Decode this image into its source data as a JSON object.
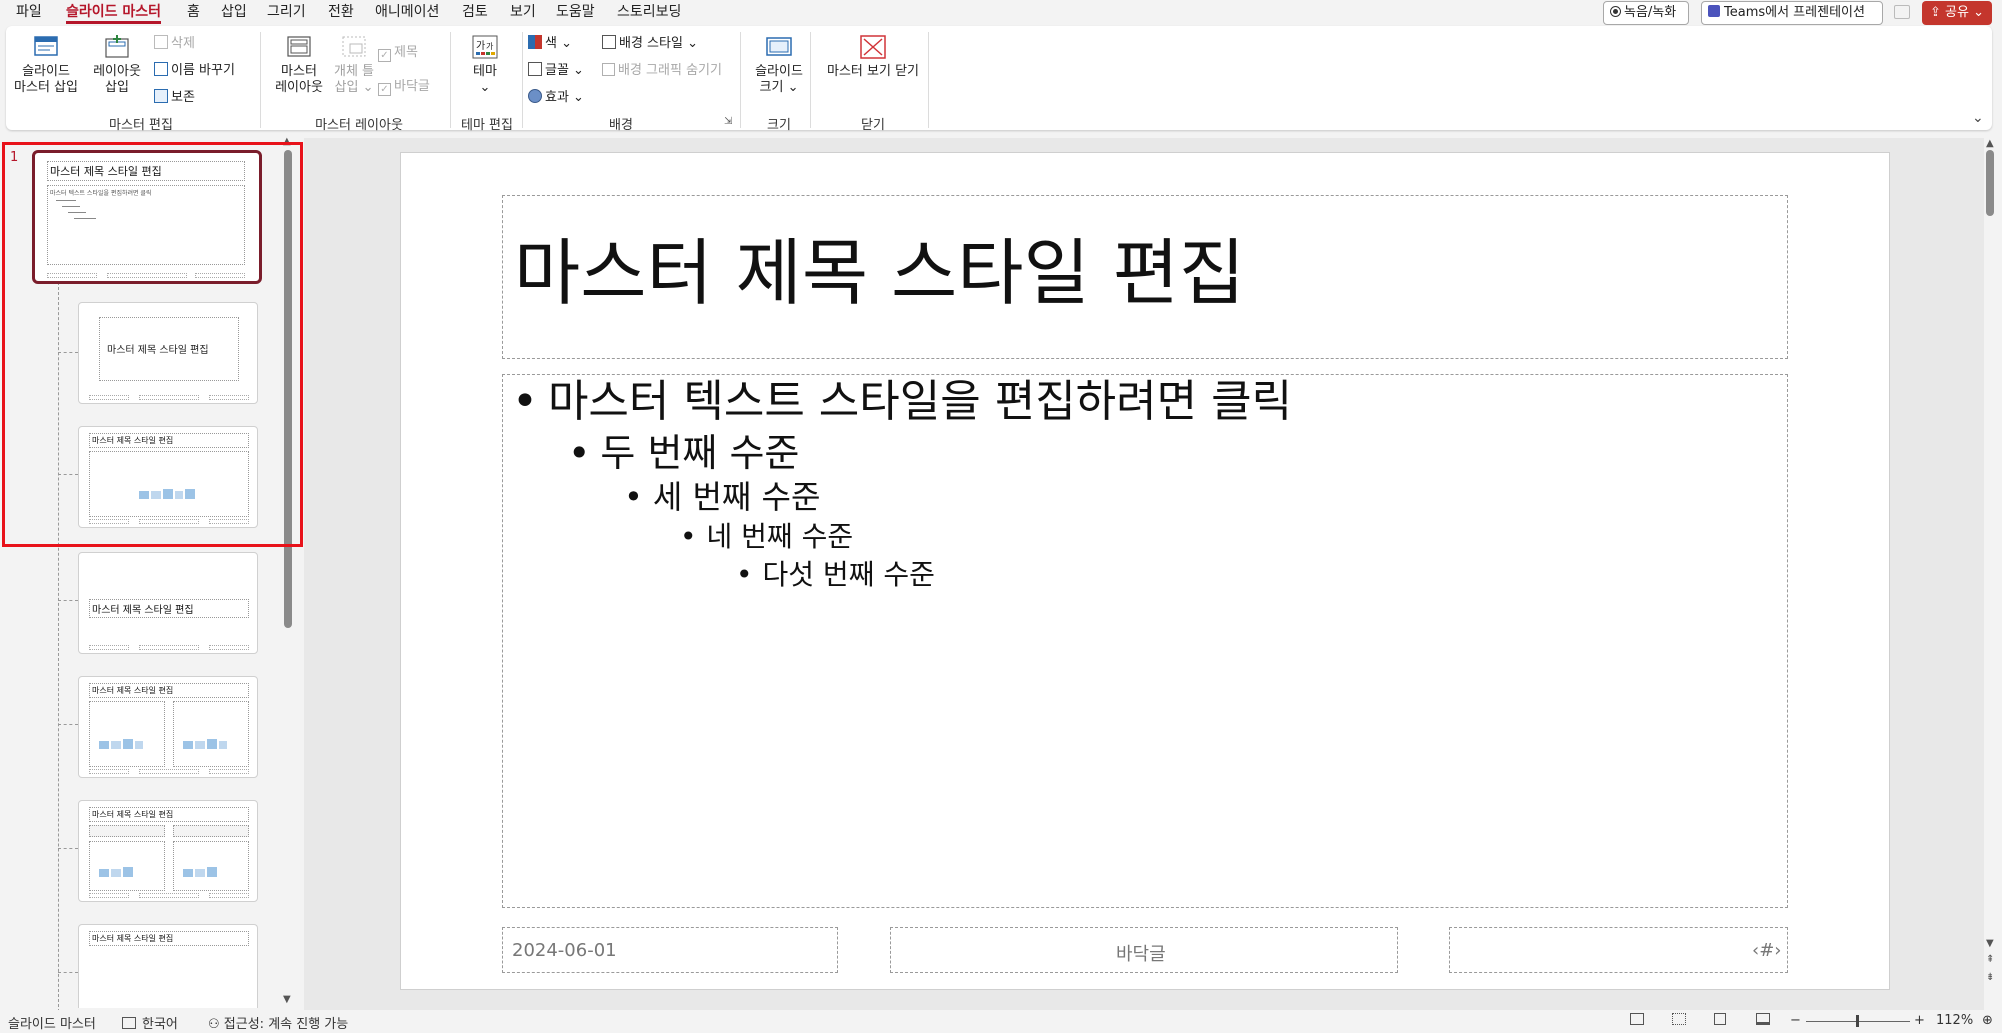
{
  "menu": {
    "tabs": [
      {
        "label": "파일"
      },
      {
        "label": "슬라이드 마스터"
      },
      {
        "label": "홈"
      },
      {
        "label": "삽입"
      },
      {
        "label": "그리기"
      },
      {
        "label": "전환"
      },
      {
        "label": "애니메이션"
      },
      {
        "label": "검토"
      },
      {
        "label": "보기"
      },
      {
        "label": "도움말"
      },
      {
        "label": "스토리보딩"
      }
    ],
    "active_tab": "슬라이드 마스터",
    "record_label": "녹음/녹화",
    "teams_label": "Teams에서 프레젠테이션",
    "share_label": "공유"
  },
  "ribbon": {
    "master_edit": {
      "insert_master_line1": "슬라이드",
      "insert_master_line2": "마스터 삽입",
      "insert_layout_line1": "레이아웃",
      "insert_layout_line2": "삽입",
      "delete": "삭제",
      "rename": "이름 바꾸기",
      "preserve": "보존",
      "group_label": "마스터 편집"
    },
    "master_layout": {
      "master_layout_line1": "마스터",
      "master_layout_line2": "레이아웃",
      "insert_placeholder_line1": "개체 틀",
      "insert_placeholder_line2": "삽입",
      "title_chk": "제목",
      "footer_chk": "바닥글",
      "group_label": "마스터 레이아웃"
    },
    "theme_edit": {
      "theme": "테마",
      "group_label": "테마 편집"
    },
    "background": {
      "colors": "색",
      "fonts": "글꼴",
      "effects": "효과",
      "bg_styles": "배경 스타일",
      "hide_bg": "배경 그래픽 숨기기",
      "group_label": "배경"
    },
    "size": {
      "slide_size_line1": "슬라이드",
      "slide_size_line2": "크기",
      "group_label": "크기"
    },
    "close": {
      "close_master": "마스터 보기 닫기",
      "group_label": "닫기"
    }
  },
  "thumbnails": {
    "slide_number": "1",
    "title_text": "마스터 제목 스타일 편집",
    "body_text": "마스터 텍스트 스타일을 편집하려면 클릭"
  },
  "slide": {
    "title": "마스터 제목 스타일 편집",
    "levels": [
      {
        "text": "마스터 텍스트 스타일을 편집하려면 클릭"
      },
      {
        "text": "두 번째 수준"
      },
      {
        "text": "세 번째 수준"
      },
      {
        "text": "네 번째 수준"
      },
      {
        "text": "다섯 번째 수준"
      }
    ],
    "footer_date": "2024-06-01",
    "footer_text": "바닥글",
    "footer_num": "‹#›"
  },
  "status": {
    "view_name": "슬라이드 마스터",
    "language": "한국어",
    "accessibility": "접근성: 계속 진행 가능",
    "zoom_minus": "−",
    "zoom_plus": "+",
    "zoom": "112%"
  },
  "colors": {
    "accent": "#b5162a",
    "share": "#c4362d",
    "highlight_box": "#e8121a",
    "master_border": "#7a1d2b"
  }
}
